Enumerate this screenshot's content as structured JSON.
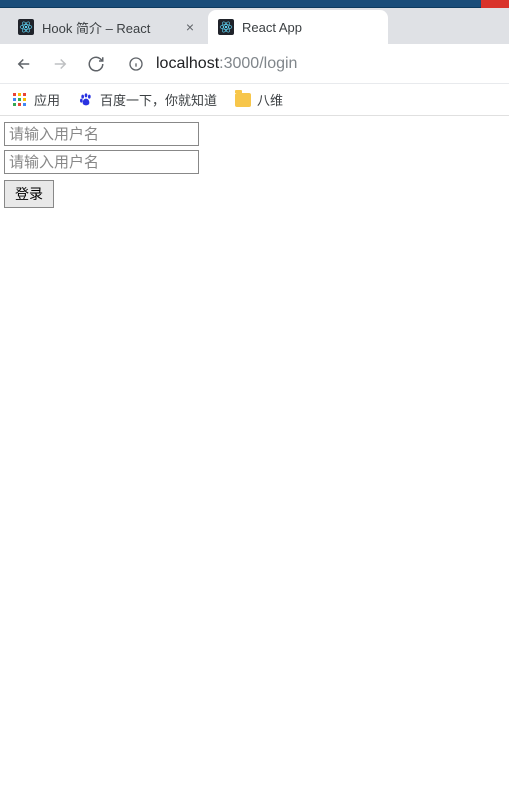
{
  "tabs": [
    {
      "title": "Hook 简介 – React",
      "active": false
    },
    {
      "title": "React App",
      "active": true
    }
  ],
  "url": {
    "host": "localhost",
    "path": ":3000/login"
  },
  "bookmarks": {
    "apps": "应用",
    "baidu": "百度一下，你就知道",
    "folder": "八维"
  },
  "form": {
    "username_placeholder": "请输入用户名",
    "password_placeholder": "请输入用户名",
    "login_label": "登录"
  }
}
